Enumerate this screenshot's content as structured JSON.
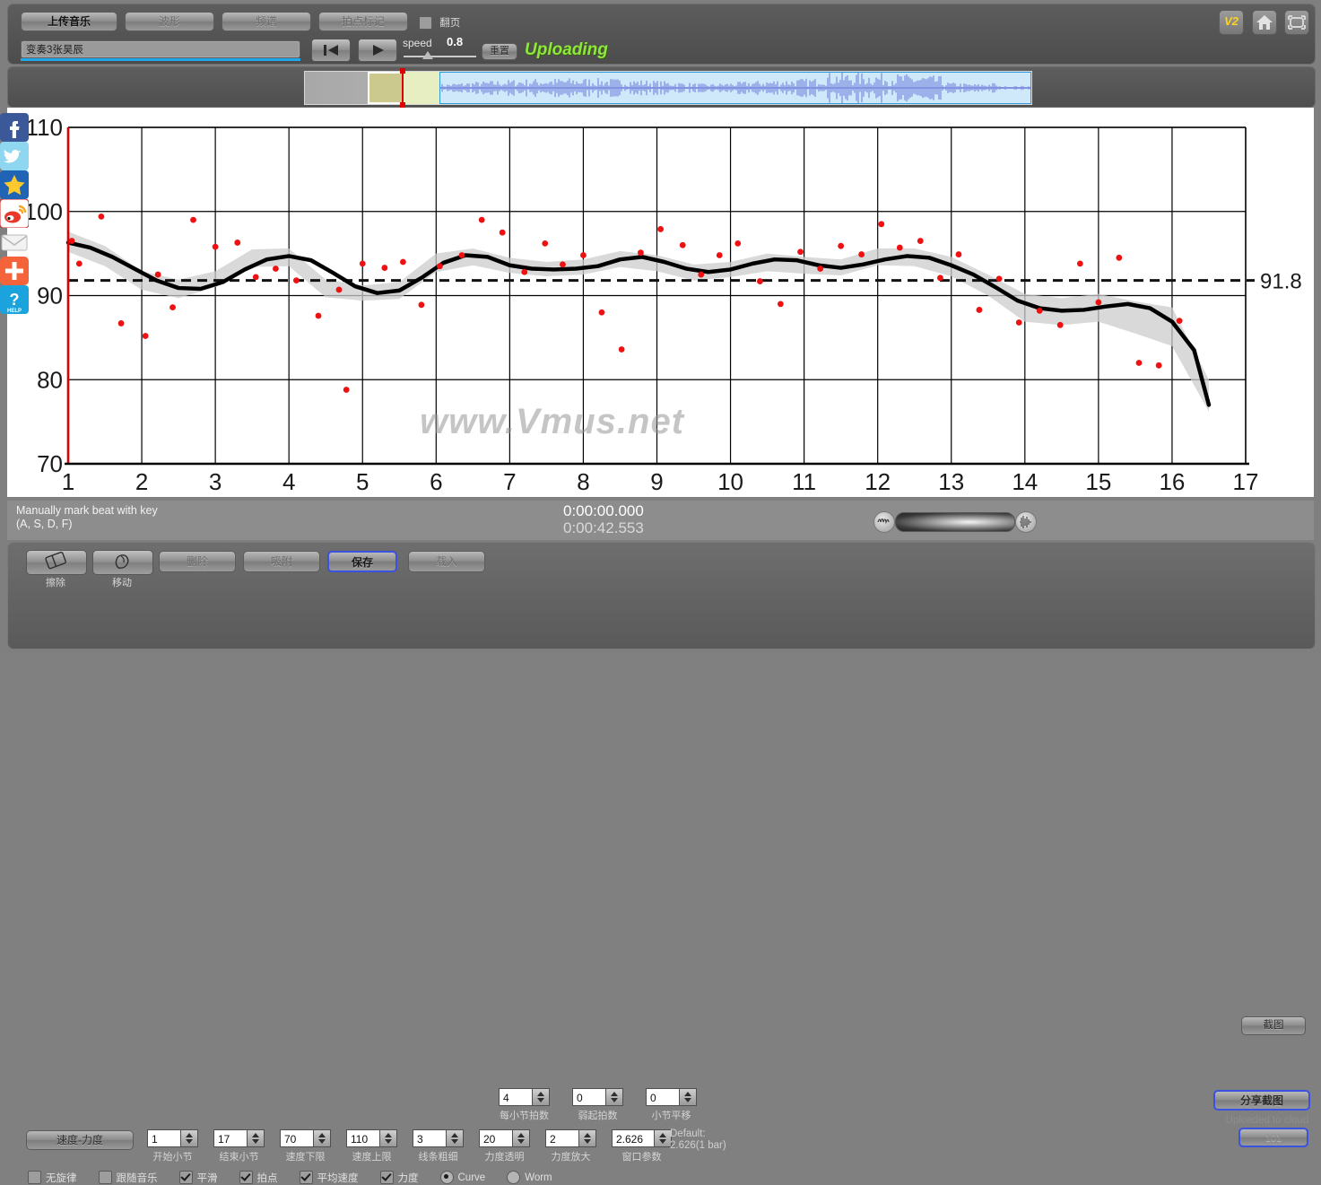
{
  "toolbar": {
    "upload_music": "上传音乐",
    "waveform": "波形",
    "spectrum": "频谱",
    "beat_mark": "拍点标记",
    "page_turn": "翻页",
    "file_name": "变奏3张昊辰",
    "speed_label": "speed",
    "speed_value": "0.8",
    "reset": "重置",
    "status": "Uploading",
    "version_badge": "V2"
  },
  "statusbar": {
    "hint_line1": "Manually mark beat with key",
    "hint_line2": "(A, S, D, F)",
    "time_current": "0:00:00.000",
    "time_total": "0:00:42.553",
    "screenshot": "截图"
  },
  "bottom": {
    "erase": "擦除",
    "move": "移动",
    "delete": "删除",
    "snap": "吸附",
    "save": "保存",
    "load": "载入",
    "tempo_dynamics": "速度-力度",
    "default_note_line1": "Default:",
    "default_note_line2": "2.626(1 bar)",
    "share_screenshot": "分享截图",
    "cloud_note": "Uploaded to cloud",
    "cloud_button": "101",
    "spinners_row1": [
      {
        "value": "4",
        "label": "每小节拍数"
      },
      {
        "value": "0",
        "label": "弱起拍数"
      },
      {
        "value": "0",
        "label": "小节平移"
      }
    ],
    "spinners_row2": [
      {
        "value": "1",
        "label": "开始小节"
      },
      {
        "value": "17",
        "label": "结束小节"
      },
      {
        "value": "70",
        "label": "速度下限"
      },
      {
        "value": "110",
        "label": "速度上限"
      },
      {
        "value": "3",
        "label": "线条粗细"
      },
      {
        "value": "20",
        "label": "力度透明"
      },
      {
        "value": "2",
        "label": "力度放大"
      },
      {
        "value": "2.626",
        "label": "窗口参数"
      }
    ],
    "checkboxes": [
      {
        "label": "无旋律",
        "checked": false
      },
      {
        "label": "跟随音乐",
        "checked": false
      },
      {
        "label": "平滑",
        "checked": true
      },
      {
        "label": "拍点",
        "checked": true
      },
      {
        "label": "平均速度",
        "checked": true
      },
      {
        "label": "力度",
        "checked": true
      }
    ],
    "radios": [
      {
        "label": "Curve",
        "selected": true
      },
      {
        "label": "Worm",
        "selected": false
      }
    ]
  },
  "chart_area": {
    "watermark": "www.Vmus.net",
    "mean_label": "91.8"
  },
  "colors": {
    "axis": "#dd0000",
    "curve": "#000000",
    "band": "#cccccc",
    "points": "#ee1111",
    "accent": "#8ee83a",
    "panel": "#5a5a5a"
  },
  "chart_data": {
    "type": "line",
    "title": "",
    "xlabel": "",
    "ylabel": "",
    "xlim": [
      1,
      17
    ],
    "ylim": [
      70,
      110
    ],
    "grid": true,
    "xticks": [
      1,
      2,
      3,
      4,
      5,
      6,
      7,
      8,
      9,
      10,
      11,
      12,
      13,
      14,
      15,
      16,
      17
    ],
    "yticks": [
      70,
      80,
      90,
      100,
      110
    ],
    "mean_line": 91.8,
    "series": [
      {
        "name": "smoothed tempo curve",
        "x": [
          1.0,
          1.3,
          1.6,
          1.9,
          2.2,
          2.5,
          2.8,
          3.1,
          3.4,
          3.7,
          4.0,
          4.3,
          4.6,
          4.9,
          5.2,
          5.5,
          5.8,
          6.1,
          6.4,
          6.7,
          7.0,
          7.3,
          7.6,
          7.9,
          8.2,
          8.5,
          8.8,
          9.1,
          9.4,
          9.7,
          10.0,
          10.3,
          10.6,
          10.9,
          11.2,
          11.5,
          11.8,
          12.1,
          12.4,
          12.7,
          13.0,
          13.3,
          13.6,
          13.9,
          14.2,
          14.5,
          14.8,
          15.1,
          15.4,
          15.7,
          16.0,
          16.3,
          16.5
        ],
        "y": [
          96.3,
          95.7,
          94.6,
          93.2,
          91.8,
          90.9,
          90.8,
          91.6,
          93.1,
          94.3,
          94.7,
          94.2,
          92.7,
          91.1,
          90.3,
          90.6,
          92.1,
          93.9,
          94.8,
          94.6,
          93.6,
          93.2,
          93.1,
          93.2,
          93.5,
          94.3,
          94.6,
          94.0,
          93.2,
          92.8,
          93.1,
          93.8,
          94.3,
          94.2,
          93.6,
          93.3,
          93.7,
          94.3,
          94.7,
          94.5,
          93.6,
          92.5,
          91.0,
          89.4,
          88.5,
          88.2,
          88.3,
          88.7,
          89.0,
          88.5,
          86.9,
          83.5,
          77.0
        ]
      },
      {
        "name": "confidence band upper",
        "x": [
          1.0,
          1.5,
          2.0,
          2.5,
          3.0,
          3.5,
          4.0,
          4.5,
          5.0,
          5.5,
          6.0,
          6.5,
          7.0,
          7.5,
          8.0,
          8.5,
          9.0,
          9.5,
          10.0,
          10.5,
          11.0,
          11.5,
          12.0,
          12.5,
          13.0,
          13.5,
          14.0,
          14.5,
          15.0,
          15.5,
          16.0,
          16.5
        ],
        "y": [
          97.6,
          95.9,
          92.9,
          91.9,
          92.9,
          95.5,
          95.6,
          91.9,
          91.2,
          91.6,
          95.0,
          95.6,
          94.5,
          94.0,
          94.3,
          95.3,
          94.8,
          93.7,
          94.0,
          95.0,
          94.6,
          94.3,
          95.6,
          95.6,
          94.6,
          92.5,
          90.2,
          89.7,
          90.2,
          89.3,
          88.6,
          80.0
        ]
      },
      {
        "name": "confidence band lower",
        "x": [
          1.0,
          1.5,
          2.0,
          2.5,
          3.0,
          3.5,
          4.0,
          4.5,
          5.0,
          5.5,
          6.0,
          6.5,
          7.0,
          7.5,
          8.0,
          8.5,
          9.0,
          9.5,
          10.0,
          10.5,
          11.0,
          11.5,
          12.0,
          12.5,
          13.0,
          13.5,
          14.0,
          14.5,
          15.0,
          15.5,
          16.0,
          16.5
        ],
        "y": [
          95.2,
          93.5,
          90.7,
          89.7,
          91.0,
          93.4,
          93.5,
          89.8,
          89.4,
          89.6,
          92.8,
          93.6,
          92.7,
          92.3,
          92.5,
          93.4,
          92.9,
          91.8,
          92.2,
          92.9,
          92.6,
          92.4,
          93.6,
          93.5,
          92.3,
          90.0,
          86.9,
          86.5,
          86.9,
          85.5,
          84.0,
          76.2
        ]
      }
    ],
    "scatter": {
      "name": "per-beat tempo",
      "x": [
        1.05,
        1.15,
        1.45,
        1.72,
        2.05,
        2.22,
        2.42,
        2.7,
        3.0,
        3.3,
        3.55,
        3.82,
        4.1,
        4.4,
        4.68,
        4.78,
        5.0,
        5.3,
        5.55,
        5.8,
        6.05,
        6.35,
        6.62,
        6.9,
        7.2,
        7.48,
        7.72,
        8.0,
        8.25,
        8.52,
        8.78,
        9.05,
        9.35,
        9.6,
        9.85,
        10.1,
        10.4,
        10.68,
        10.95,
        11.22,
        11.5,
        11.78,
        12.05,
        12.3,
        12.58,
        12.85,
        13.1,
        13.38,
        13.65,
        13.92,
        14.2,
        14.48,
        14.75,
        15.0,
        15.28,
        15.55,
        15.82,
        16.1
      ],
      "y": [
        96.5,
        93.8,
        99.4,
        86.7,
        85.2,
        92.5,
        88.6,
        99.0,
        95.8,
        96.3,
        92.2,
        93.2,
        91.8,
        87.6,
        90.7,
        78.8,
        93.8,
        93.3,
        94.0,
        88.9,
        93.5,
        94.8,
        99.0,
        97.5,
        92.8,
        96.2,
        93.7,
        94.8,
        88.0,
        83.6,
        95.1,
        97.9,
        96.0,
        92.5,
        94.8,
        96.2,
        91.7,
        89.0,
        95.2,
        93.2,
        95.9,
        94.9,
        98.5,
        95.7,
        96.5,
        92.1,
        94.9,
        88.3,
        92.0,
        86.8,
        88.2,
        86.5,
        93.8,
        89.2,
        94.5,
        82.0,
        81.7,
        87.0
      ]
    }
  }
}
